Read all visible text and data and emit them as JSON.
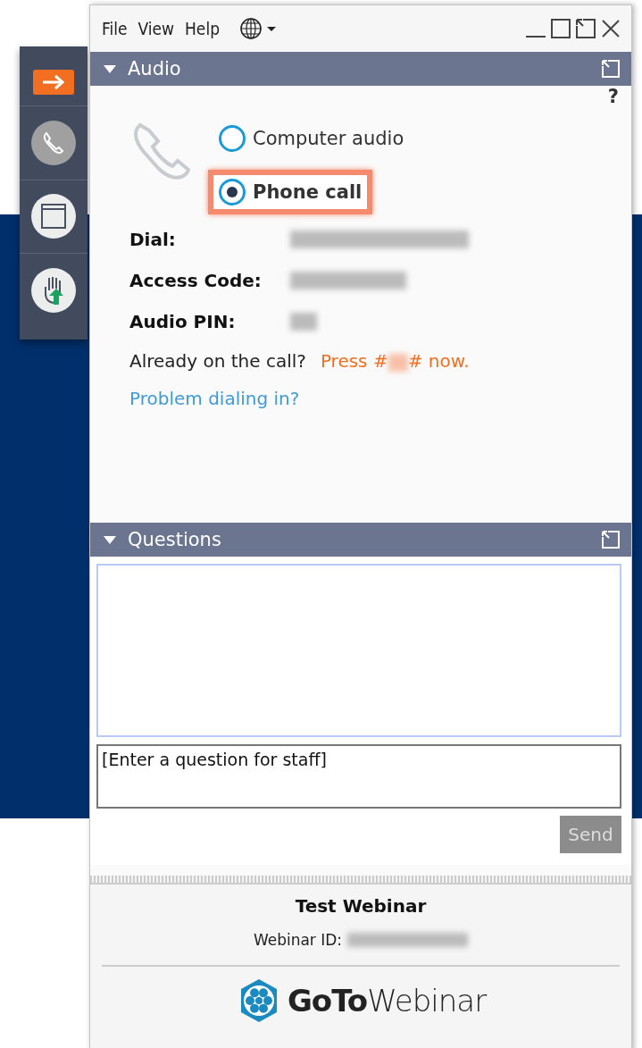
{
  "toolbar": {
    "items": [
      {
        "kind": "collapse",
        "selected": true
      },
      {
        "kind": "audio",
        "selected": false
      },
      {
        "kind": "screen",
        "selected": false
      },
      {
        "kind": "hand",
        "selected": false
      }
    ]
  },
  "menu": [
    "File",
    "View",
    "Help"
  ],
  "audio_panel": {
    "title": "Audio",
    "expanded": true,
    "help": "?",
    "options": [
      {
        "label": "Computer audio",
        "selected": false,
        "highlighted": false
      },
      {
        "label": "Phone call",
        "selected": true,
        "highlighted": true
      }
    ],
    "details": [
      {
        "label": "Dial:",
        "redacted": true
      },
      {
        "label": "Access Code:",
        "redacted": true
      },
      {
        "label": "Audio PIN:",
        "redacted": true
      }
    ],
    "already": "Already on the call?",
    "press_prefix": "Press #",
    "press_suffix": "# now.",
    "problem_link": "Problem dialing in?"
  },
  "questions_panel": {
    "title": "Questions",
    "expanded": true,
    "placeholder": "[Enter a question for staff]",
    "send": "Send",
    "send_disabled": true
  },
  "footer": {
    "webinar_title": "Test Webinar",
    "id_label": "Webinar ID:",
    "id_redacted": true,
    "logo_bold": "GoTo",
    "logo_light": "Webinar"
  }
}
